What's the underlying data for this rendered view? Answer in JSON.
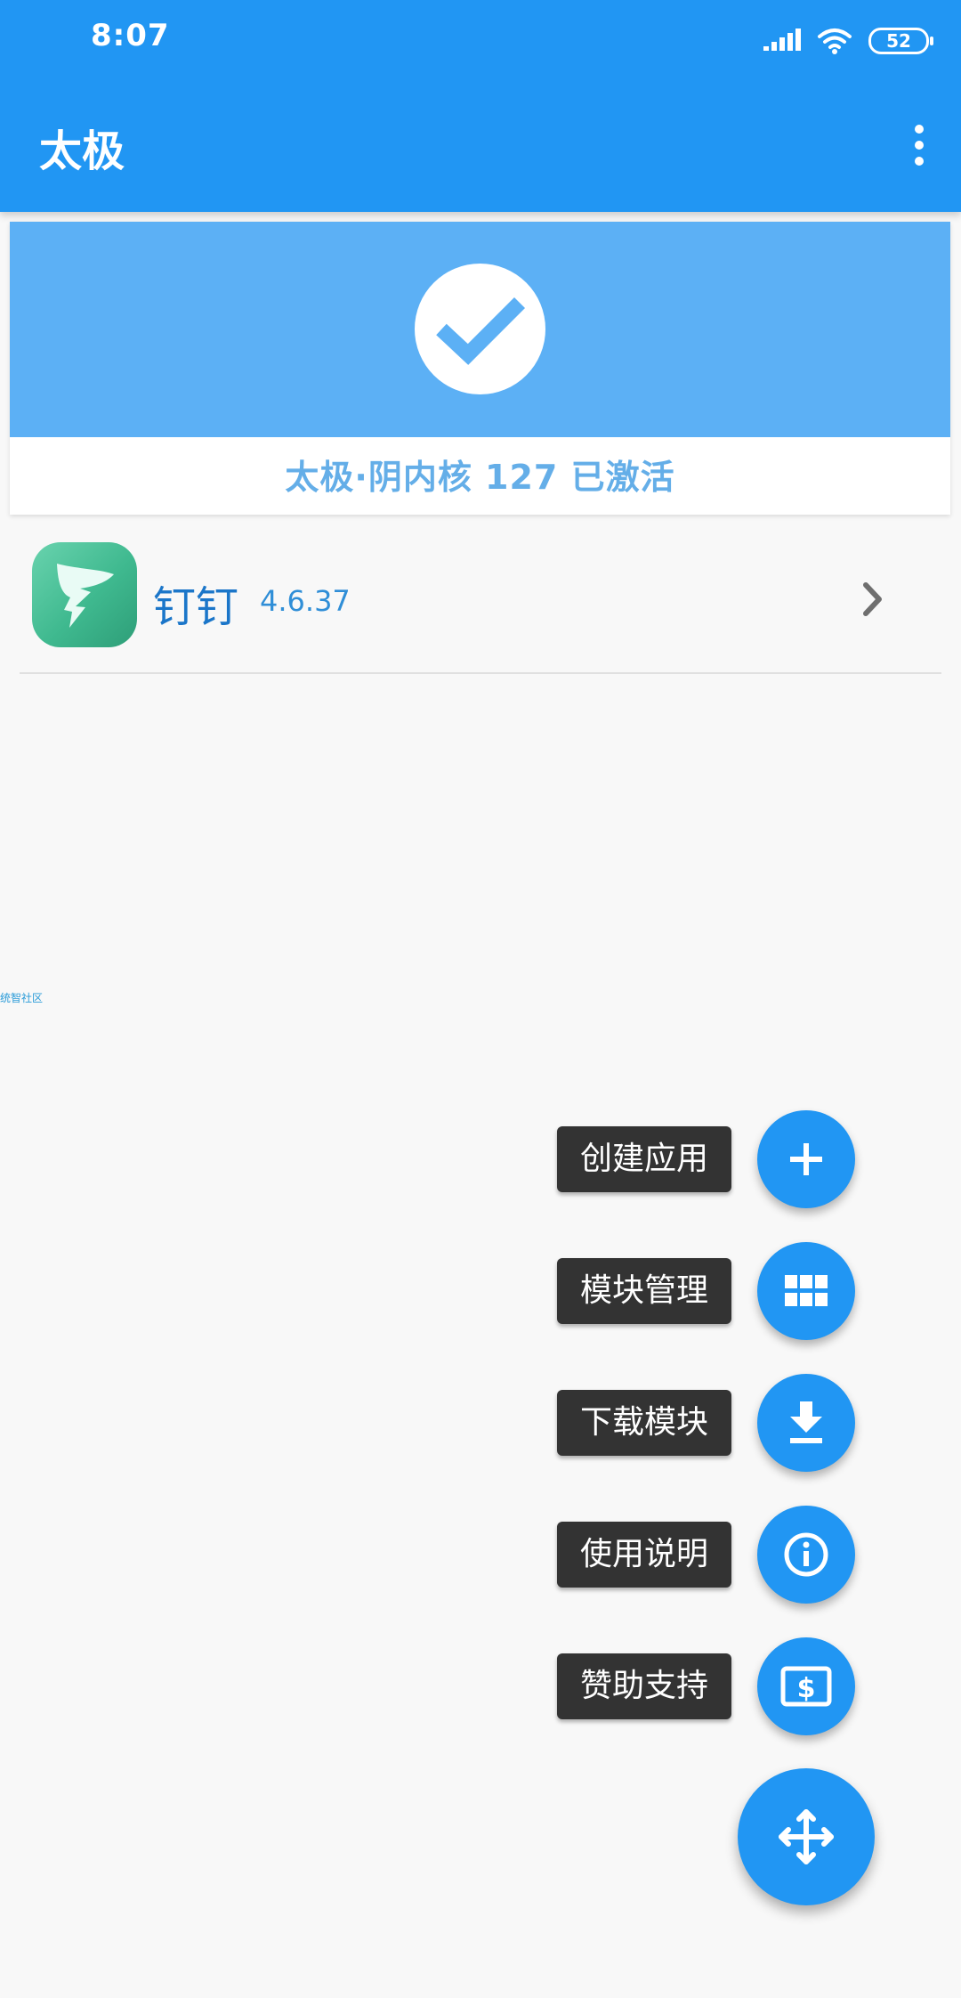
{
  "status_bar": {
    "time": "8:07",
    "battery": "52",
    "signal_icon": "signal-icon",
    "wifi_icon": "wifi-icon"
  },
  "app_bar": {
    "title": "太极",
    "menu_icon": "more-vertical-icon"
  },
  "status_card": {
    "status_text": "太极·阴内核 127 已激活",
    "icon": "check-icon",
    "banner_color": "#5cb0f5"
  },
  "apps": [
    {
      "name": "钉钉",
      "version": "4.6.37",
      "icon": "dingtalk-icon"
    }
  ],
  "watermark": "统智社区",
  "speed_dial": [
    {
      "label": "创建应用",
      "icon": "plus-icon"
    },
    {
      "label": "模块管理",
      "icon": "grid-icon"
    },
    {
      "label": "下载模块",
      "icon": "download-icon"
    },
    {
      "label": "使用说明",
      "icon": "info-icon"
    },
    {
      "label": "赞助支持",
      "icon": "donate-icon"
    }
  ],
  "main_fab": {
    "icon": "move-icon"
  },
  "colors": {
    "primary": "#2196f3",
    "label_background": "#333333",
    "app_name": "#1b76c9"
  }
}
